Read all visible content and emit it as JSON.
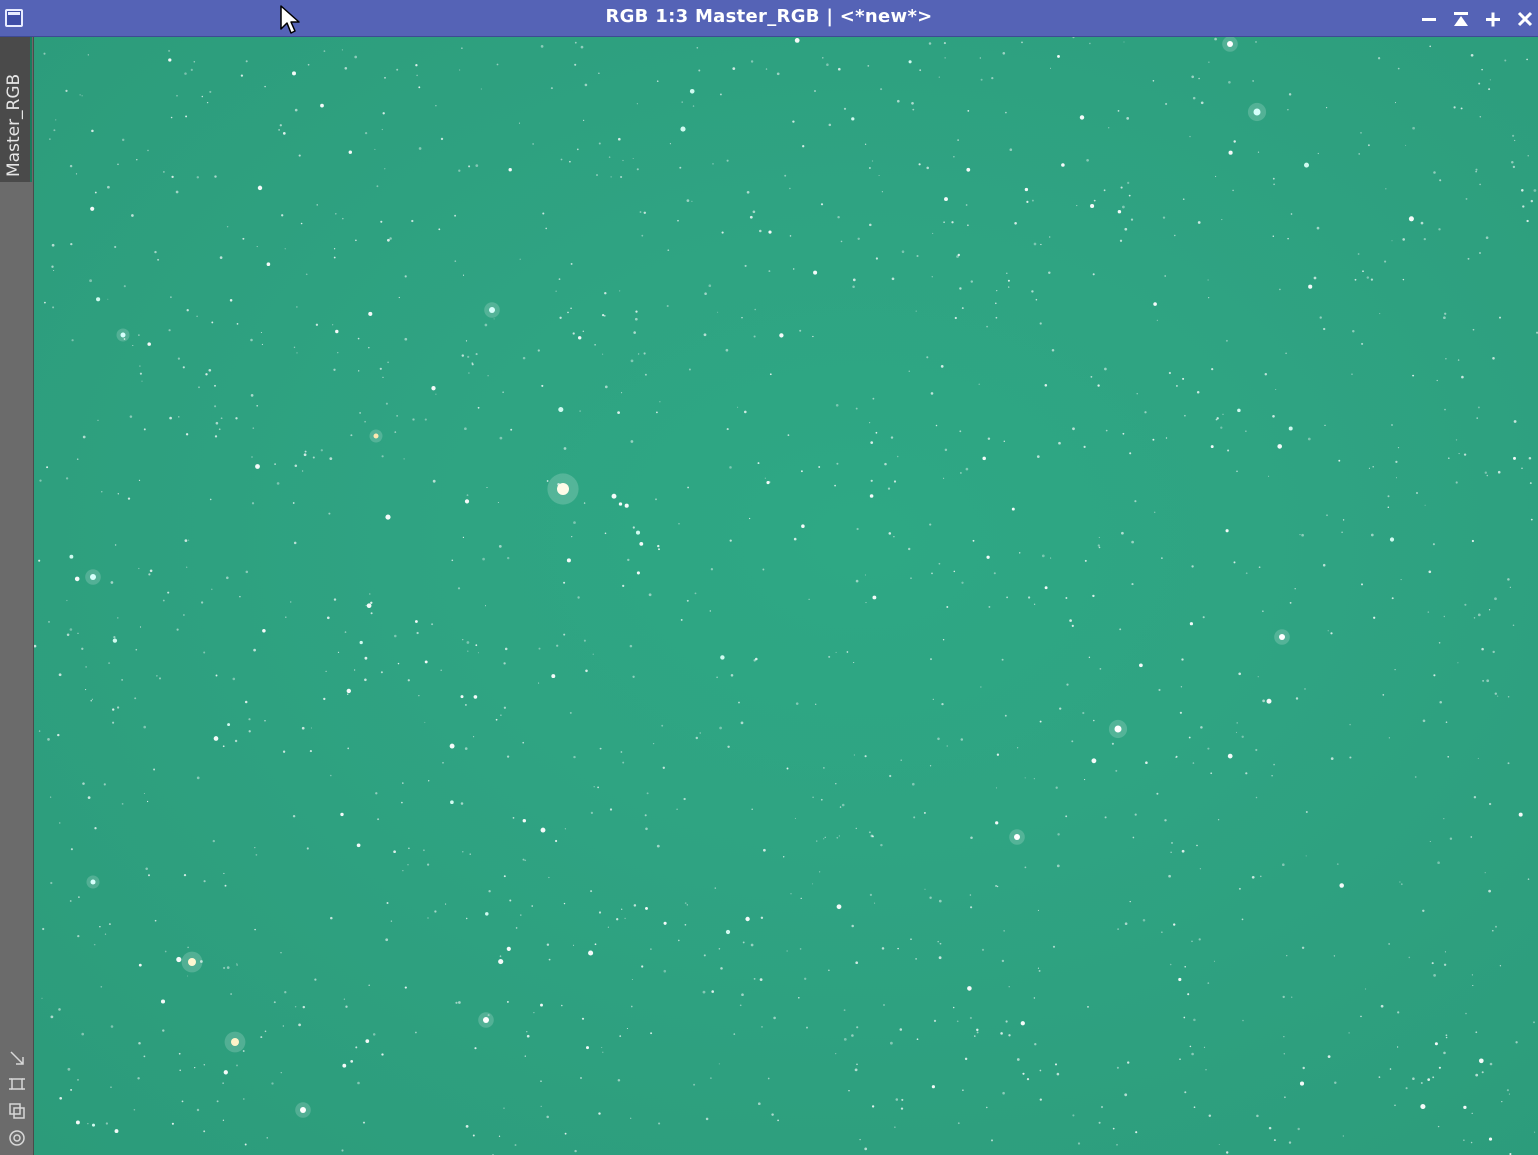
{
  "window": {
    "title": "RGB 1:3 Master_RGB | <*new*>",
    "controls": {
      "minimize_icon": "minimize-icon",
      "shade_icon": "shade-icon",
      "maximize_icon": "maximize-icon",
      "close_icon": "close-icon"
    },
    "colors": {
      "titlebar": "#5563b6",
      "image_background": "#2fa382",
      "side_panel": "#6b6b6b"
    }
  },
  "side_panel": {
    "view_tab_label": "Master_RGB",
    "tools": [
      "arrow-pointer-icon",
      "crop-frame-icon",
      "duplicate-icon",
      "target-icon"
    ]
  }
}
